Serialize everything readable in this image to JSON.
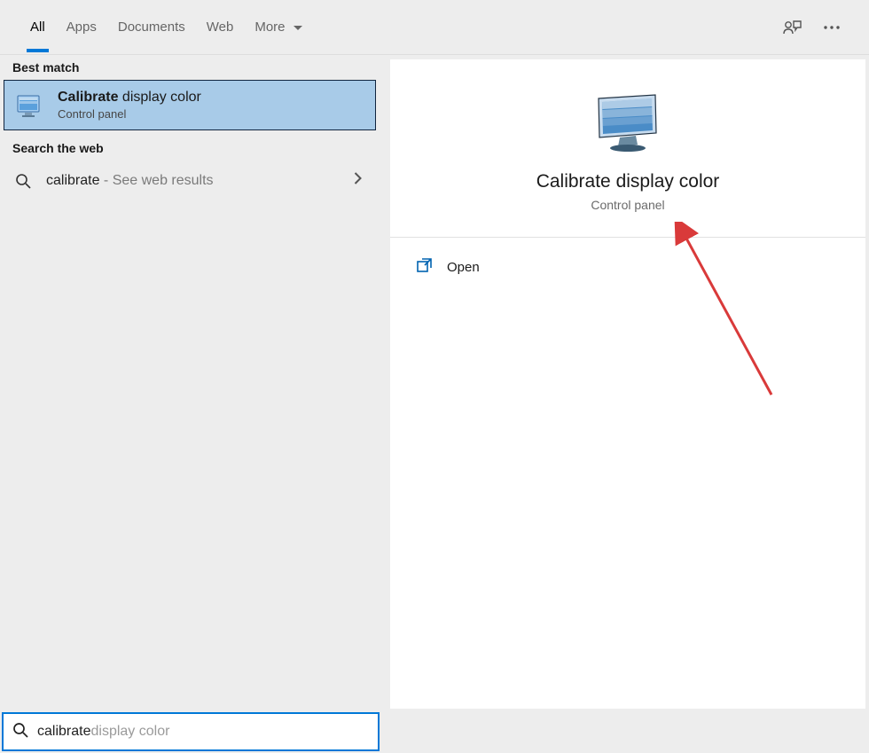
{
  "tabs": [
    "All",
    "Apps",
    "Documents",
    "Web",
    "More"
  ],
  "active_tab": "All",
  "best_match_label": "Best match",
  "best_match": {
    "title_bold": "Calibrate",
    "title_rest": " display color",
    "subtitle": "Control panel"
  },
  "web_label": "Search the web",
  "web_item": {
    "term": "calibrate",
    "suffix": " - See web results"
  },
  "detail": {
    "title": "Calibrate display color",
    "subtitle": "Control panel",
    "open_label": "Open"
  },
  "search": {
    "typed": "calibrate",
    "ghost": " display color"
  }
}
